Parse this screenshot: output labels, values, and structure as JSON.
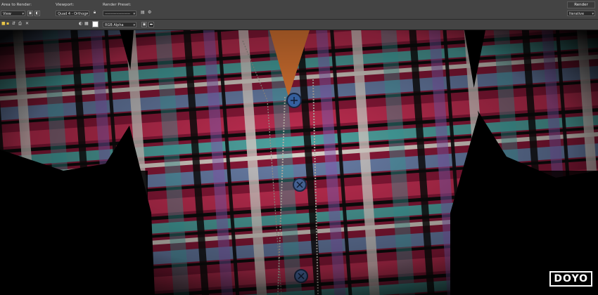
{
  "toolbar": {
    "area_to_render_label": "Area to Render:",
    "area_value": "View",
    "viewport_label": "Viewport:",
    "viewport_value": "Quad 4 - Orthogr",
    "render_preset_label": "Render Preset:",
    "render_preset_value": "--------------------",
    "render_button": "Render",
    "render_mode": "Iterative",
    "channel_value": "RGB Alpha"
  },
  "colors": {
    "toolbar_bg": "#444444",
    "channel_red": "#d42020",
    "channel_green": "#1e9e35",
    "channel_blue": "#1b4fd9"
  },
  "icons": [
    "lock-icon",
    "render-frame-icon",
    "settings-icon",
    "save-icon",
    "copy-icon",
    "clone-icon",
    "print-icon",
    "clear-icon",
    "display-icon",
    "mono-icon",
    "swatch-icon"
  ],
  "watermark": {
    "text": "DOYO"
  }
}
